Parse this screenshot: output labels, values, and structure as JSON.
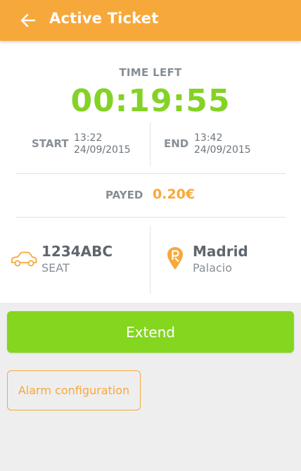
{
  "appbar": {
    "title": "Active Ticket",
    "back_icon": "arrow-left-icon"
  },
  "ticket": {
    "time_left_label": "TIME LEFT",
    "countdown": "00:19:55",
    "start": {
      "label": "START",
      "time": "13:22",
      "date": "24/09/2015"
    },
    "end": {
      "label": "END",
      "time": "13:42",
      "date": "24/09/2015"
    },
    "payment": {
      "label": "PAYED",
      "amount": "0.20€"
    },
    "vehicle": {
      "icon": "car-icon",
      "plate": "1234ABC",
      "make": "SEAT"
    },
    "zone": {
      "icon": "parking-pin-icon",
      "city": "Madrid",
      "area": "Palacio"
    }
  },
  "actions": {
    "extend_label": "Extend",
    "alarm_label": "Alarm configuration"
  },
  "colors": {
    "accent_orange": "#f7a83a",
    "accent_green": "#85d61f",
    "countdown_green": "#85d226"
  }
}
